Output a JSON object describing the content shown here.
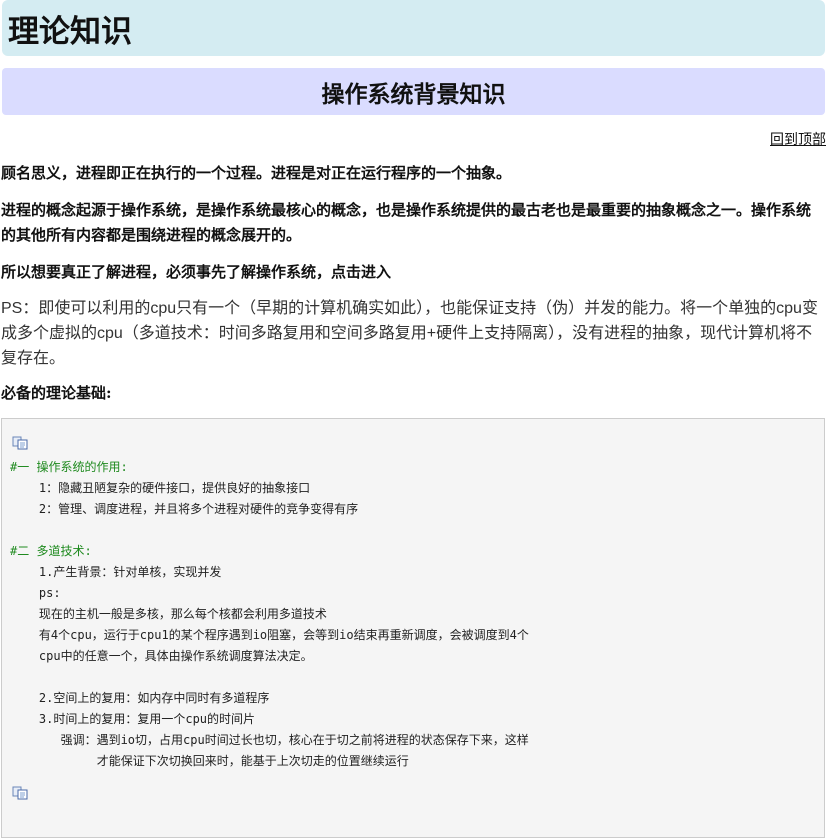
{
  "header": {
    "title": "理论知识",
    "subtitle": "操作系统背景知识",
    "back_to_top": "回到顶部"
  },
  "article": {
    "p1": "顾名思义，进程即正在执行的一个过程。进程是对正在运行程序的一个抽象。",
    "p2": "进程的概念起源于操作系统，是操作系统最核心的概念，也是操作系统提供的最古老也是最重要的抽象概念之一。操作系统的其他所有内容都是围绕进程的概念展开的。",
    "p3": "所以想要真正了解进程，必须事先了解操作系统，点击进入",
    "p4": "PS：即使可以利用的cpu只有一个（早期的计算机确实如此），也能保证支持（伪）并发的能力。将一个单独的cpu变成多个虚拟的cpu（多道技术：时间多路复用和空间多路复用+硬件上支持隔离），没有进程的抽象，现代计算机将不复存在。",
    "p5": "必备的理论基础:"
  },
  "code": {
    "lines": [
      {
        "text": "#一 操作系统的作用:",
        "comment": true
      },
      {
        "text": "    1：隐藏丑陋复杂的硬件接口，提供良好的抽象接口",
        "comment": false
      },
      {
        "text": "    2：管理、调度进程，并且将多个进程对硬件的竞争变得有序",
        "comment": false
      },
      {
        "text": "",
        "comment": false
      },
      {
        "text": "#二 多道技术:",
        "comment": true
      },
      {
        "text": "    1.产生背景：针对单核，实现并发",
        "comment": false
      },
      {
        "text": "    ps:",
        "comment": false
      },
      {
        "text": "    现在的主机一般是多核，那么每个核都会利用多道技术",
        "comment": false
      },
      {
        "text": "    有4个cpu，运行于cpu1的某个程序遇到io阻塞，会等到io结束再重新调度，会被调度到4个",
        "comment": false
      },
      {
        "text": "    cpu中的任意一个，具体由操作系统调度算法决定。",
        "comment": false
      },
      {
        "text": "",
        "comment": false
      },
      {
        "text": "    2.空间上的复用：如内存中同时有多道程序",
        "comment": false
      },
      {
        "text": "    3.时间上的复用：复用一个cpu的时间片",
        "comment": false
      },
      {
        "text": "       强调：遇到io切，占用cpu时间过长也切，核心在于切之前将进程的状态保存下来，这样",
        "comment": false
      },
      {
        "text": "            才能保证下次切换回来时，能基于上次切走的位置继续运行",
        "comment": false
      }
    ],
    "icon": "copy-code-icon"
  },
  "colors": {
    "header_bg": "#d4ecf2",
    "subheader_bg": "#dadcff",
    "code_bg": "#f5f5f5",
    "comment": "#1f8a1f"
  }
}
